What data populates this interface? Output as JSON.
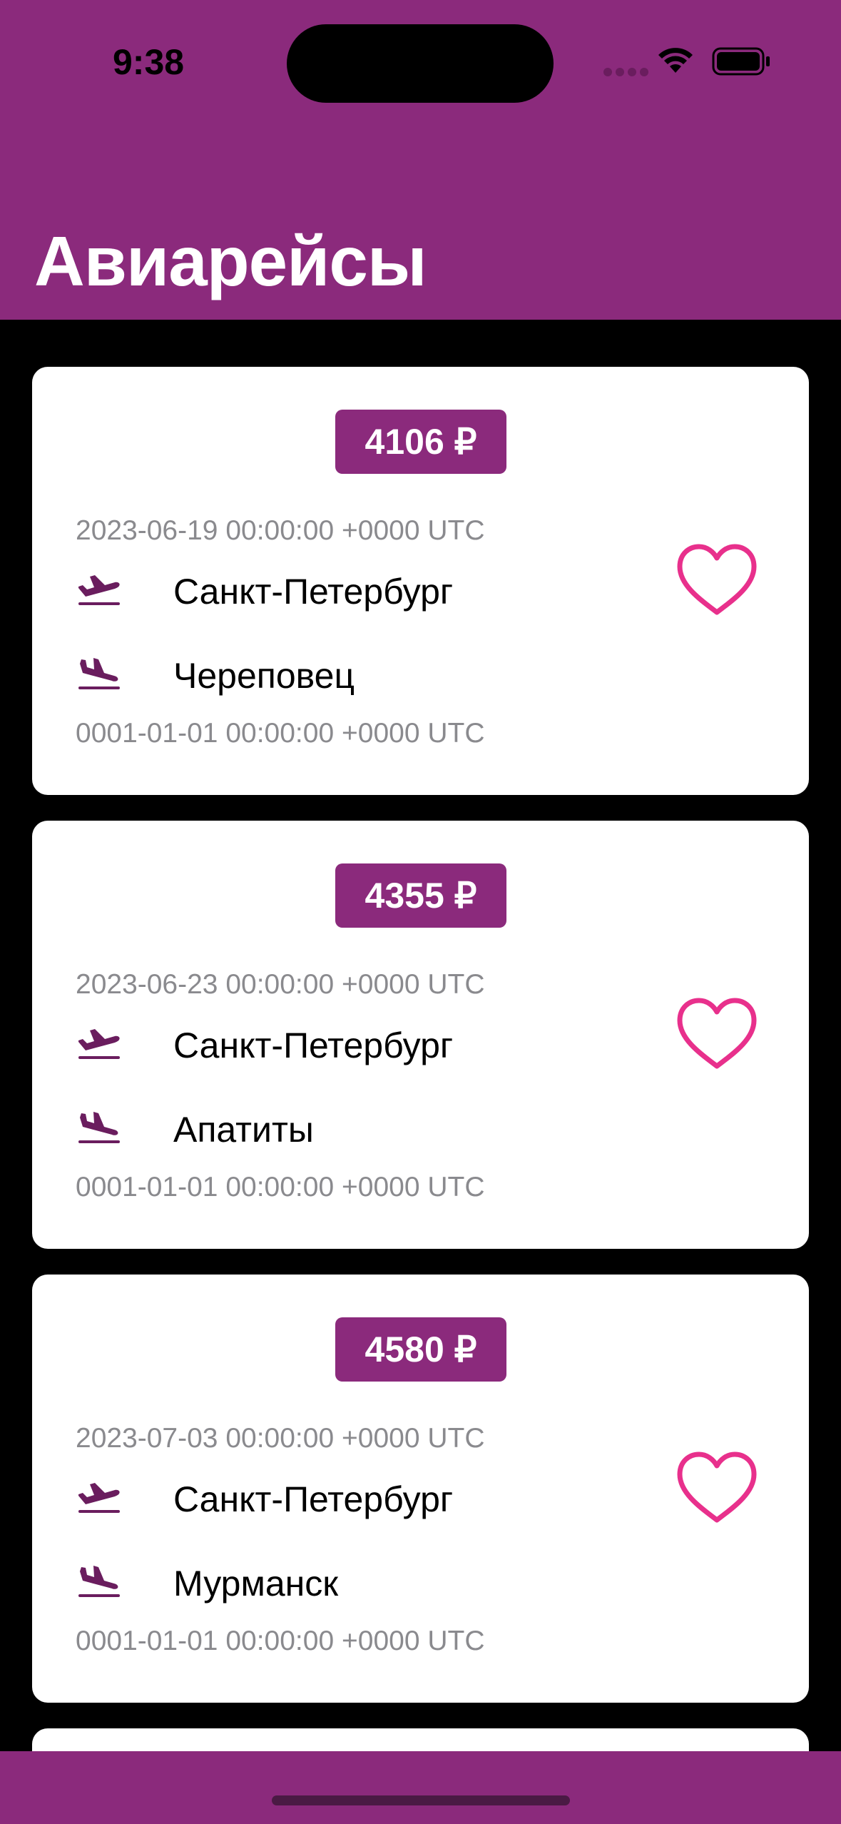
{
  "status_bar": {
    "time": "9:38"
  },
  "header": {
    "title": "Авиарейсы"
  },
  "colors": {
    "accent": "#8b2a7c",
    "heart": "#e8308c",
    "plane": "#6a1d5e"
  },
  "icons": {
    "departure": "plane-departure-icon",
    "arrival": "plane-arrival-icon",
    "favorite": "heart-outline-icon"
  },
  "flights": [
    {
      "price": "4106 ₽",
      "departure_date": "2023-06-19 00:00:00 +0000 UTC",
      "from": "Санкт-Петербург",
      "to": "Череповец",
      "arrival_date": "0001-01-01 00:00:00 +0000 UTC"
    },
    {
      "price": "4355 ₽",
      "departure_date": "2023-06-23 00:00:00 +0000 UTC",
      "from": "Санкт-Петербург",
      "to": "Апатиты",
      "arrival_date": "0001-01-01 00:00:00 +0000 UTC"
    },
    {
      "price": "4580 ₽",
      "departure_date": "2023-07-03 00:00:00 +0000 UTC",
      "from": "Санкт-Петербург",
      "to": "Мурманск",
      "arrival_date": "0001-01-01 00:00:00 +0000 UTC"
    }
  ]
}
